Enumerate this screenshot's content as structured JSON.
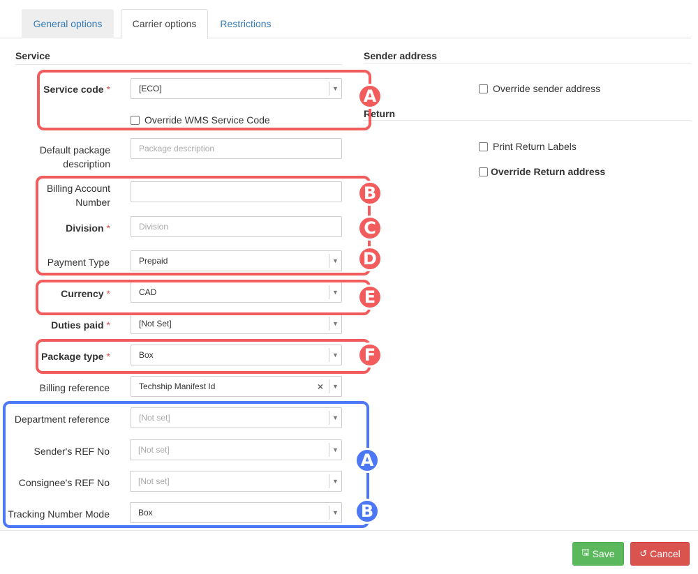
{
  "tabs": [
    {
      "label": "General options"
    },
    {
      "label": "Carrier options"
    },
    {
      "label": "Restrictions"
    }
  ],
  "sections": {
    "service": "Service",
    "sender_address": "Sender address",
    "return": "Return"
  },
  "fields": {
    "service_code": {
      "label": "Service code",
      "value": "[ECO]"
    },
    "override_wms": {
      "label": "Override WMS Service Code"
    },
    "default_package": {
      "label_line1": "Default package",
      "label_line2": "description",
      "placeholder": "Package description"
    },
    "billing_account": {
      "label_line1": "Billing Account",
      "label_line2": "Number",
      "value": ""
    },
    "division": {
      "label": "Division",
      "placeholder": "Division"
    },
    "payment_type": {
      "label": "Payment Type",
      "value": "Prepaid"
    },
    "currency": {
      "label": "Currency",
      "value": "CAD"
    },
    "duties_paid": {
      "label": "Duties paid",
      "value": "[Not Set]"
    },
    "package_type": {
      "label": "Package type",
      "value": "Box"
    },
    "billing_reference": {
      "label": "Billing reference",
      "value": "Techship Manifest Id"
    },
    "department_reference": {
      "label": "Department reference",
      "value": "[Not set]"
    },
    "senders_ref": {
      "label": "Sender's REF No",
      "value": "[Not set]"
    },
    "consignees_ref": {
      "label": "Consignee's REF No",
      "value": "[Not set]"
    },
    "tracking_mode": {
      "label": "Tracking Number Mode",
      "value": "Box"
    }
  },
  "sender": {
    "override_sender": "Override sender address",
    "print_return": "Print Return Labels",
    "override_return": "Override Return address"
  },
  "markers": {
    "red": [
      "A",
      "B",
      "C",
      "D",
      "E",
      "F"
    ],
    "blue": [
      "A",
      "B"
    ]
  },
  "buttons": {
    "save": "Save",
    "cancel": "Cancel"
  },
  "icons": {
    "caret": "caret-down-icon",
    "clear": "clear-icon",
    "save": "floppy-icon",
    "cancel": "undo-icon"
  },
  "colors": {
    "red_annotation": "#f25c5c",
    "blue_annotation": "#4d78f5",
    "save_green": "#5cb85c",
    "cancel_red": "#d9534f",
    "link_blue": "#337ab7"
  }
}
